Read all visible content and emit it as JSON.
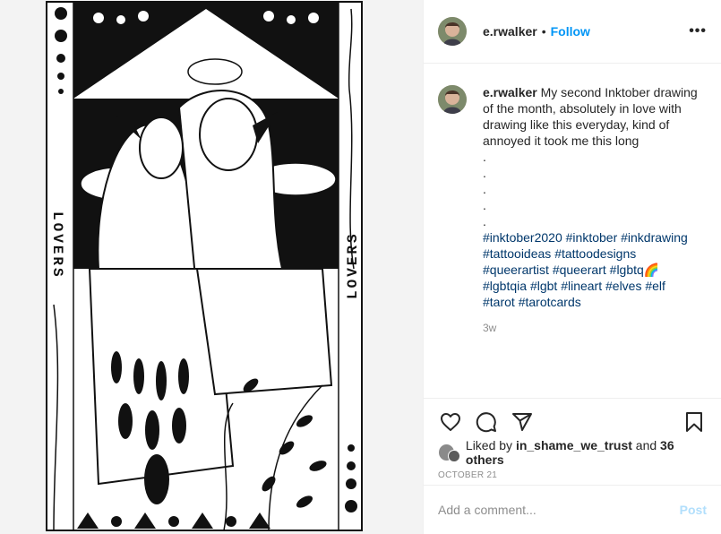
{
  "post": {
    "username": "e.rwalker",
    "follow_label": "Follow",
    "dot": "•",
    "more": "•••"
  },
  "artwork": {
    "left_label": "LOVERS",
    "right_label": "LOVERS"
  },
  "caption": {
    "username": "e.rwalker",
    "text": "My second Inktober drawing of the month, absolutely in love with drawing like this everyday, kind of annoyed it took me this long",
    "dots": [
      ".",
      ".",
      ".",
      ".",
      "."
    ],
    "hashtags": [
      "#inktober2020",
      "#inktober",
      "#inkdrawing",
      "#tattooideas",
      "#tattoodesigns",
      "#queerartist",
      "#queerart",
      "#lgbtq🌈",
      "#lgbtqia",
      "#lgbt",
      "#lineart",
      "#elves",
      "#elf",
      "#tarot",
      "#tarotcards"
    ],
    "time": "3w"
  },
  "likes": {
    "prefix": "Liked by ",
    "user": "in_shame_we_trust",
    "middle": " and ",
    "others": "36 others"
  },
  "date": "OCTOBER 21",
  "comment_box": {
    "placeholder": "Add a comment...",
    "post_label": "Post"
  },
  "colors": {
    "follow": "#0095f6",
    "post_disabled": "#b2dffc",
    "hashtag": "#00376b",
    "secondary": "#8e8e8e"
  }
}
